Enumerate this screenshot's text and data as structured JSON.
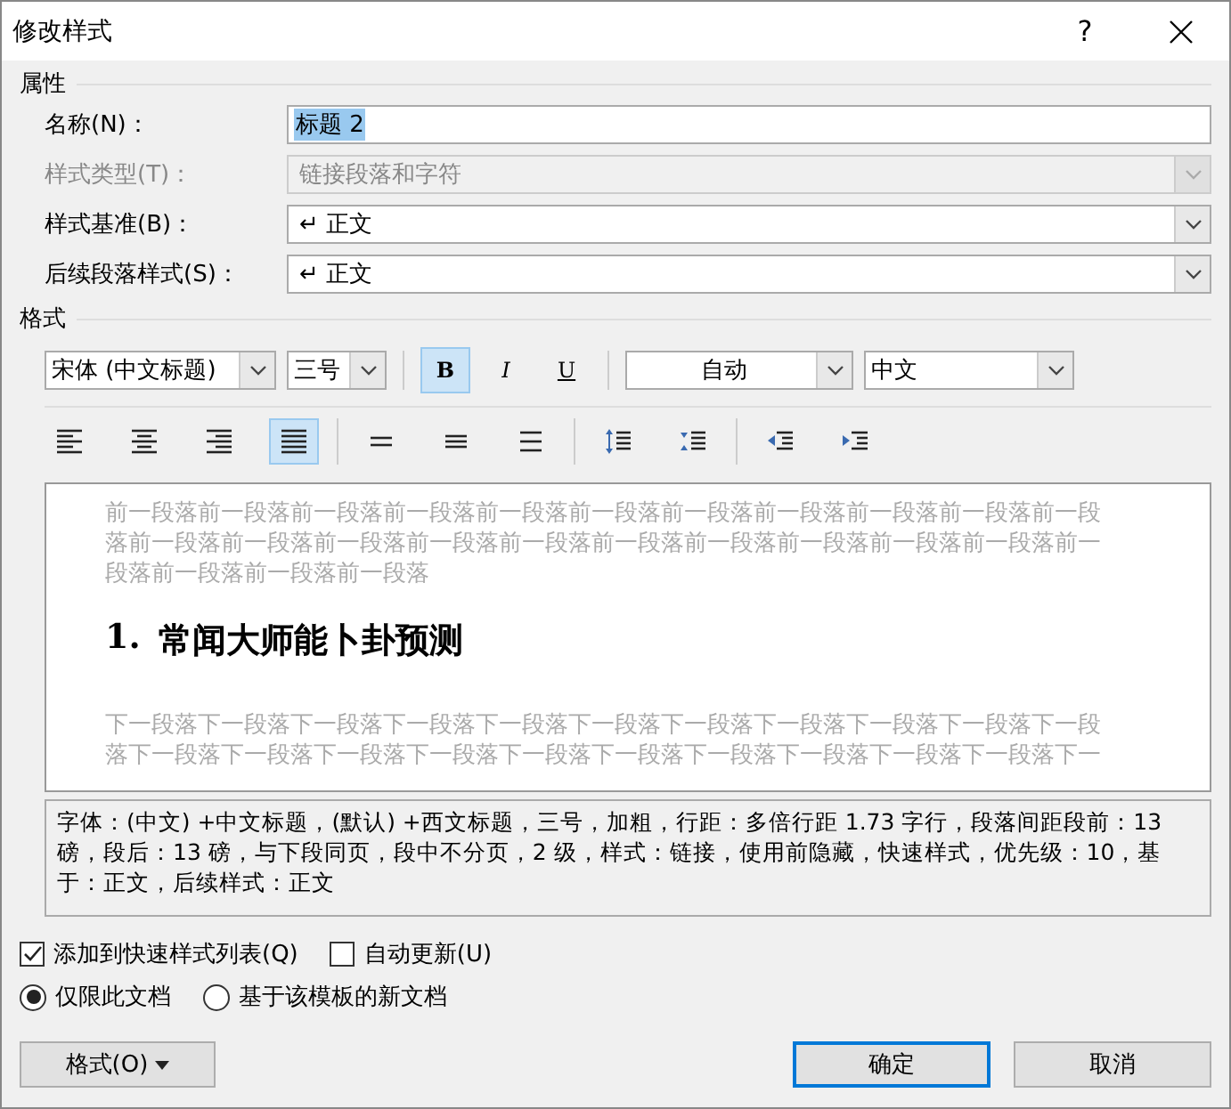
{
  "window": {
    "title": "修改样式",
    "help": "?"
  },
  "properties": {
    "heading": "属性",
    "rows": [
      {
        "label": "名称(N)：",
        "kind": "text",
        "value": "标题 2",
        "disabled": false
      },
      {
        "label": "样式类型(T)：",
        "kind": "combo",
        "value": "链接段落和字符",
        "disabled": true
      },
      {
        "label": "样式基准(B)：",
        "kind": "combo",
        "value": "↵ 正文",
        "disabled": false
      },
      {
        "label": "后续段落样式(S)：",
        "kind": "combo",
        "value": "↵ 正文",
        "disabled": false
      }
    ]
  },
  "format": {
    "heading": "格式",
    "font": "宋体 (中文标题)",
    "size": "三号",
    "styles": [
      {
        "label": "B",
        "kind": "bold",
        "selected": true
      },
      {
        "label": "I",
        "kind": "italic",
        "selected": false
      },
      {
        "label": "U",
        "kind": "underline",
        "selected": false
      }
    ],
    "color_option": "自动",
    "language": "中文",
    "paragraph_groups": [
      [
        {
          "kind": "align-left",
          "selected": false
        },
        {
          "kind": "align-center",
          "selected": false
        },
        {
          "kind": "align-right",
          "selected": false
        },
        {
          "kind": "justify",
          "selected": true
        }
      ],
      [
        {
          "kind": "single",
          "selected": false
        },
        {
          "kind": "one-half",
          "selected": false
        },
        {
          "kind": "double",
          "selected": false
        }
      ],
      [
        {
          "kind": "space-up",
          "selected": false
        },
        {
          "kind": "space-down",
          "selected": false
        }
      ],
      [
        {
          "kind": "outdent",
          "selected": false
        },
        {
          "kind": "indent",
          "selected": false
        }
      ]
    ]
  },
  "preview": {
    "before": "前一段落前一段落前一段落前一段落前一段落前一段落前一段落前一段落前一段落前一段落前一段落前一段落前一段落前一段落前一段落前一段落前一段落前一段落前一段落前一段落前一段落前一段落前一段落前一段落前一段落",
    "number": "1.",
    "heading": "常闻大师能卜卦预测",
    "after": "下一段落下一段落下一段落下一段落下一段落下一段落下一段落下一段落下一段落下一段落下一段落下一段落下一段落下一段落下一段落下一段落下一段落下一段落下一段落下一段落下一段落下一"
  },
  "description": "字体：(中文) +中文标题，(默认) +西文标题，三号，加粗，行距：多倍行距 1.73 字行，段落间距段前：13 磅，段后：13 磅，与下段同页，段中不分页，2 级，样式：链接，使用前隐藏，快速样式，优先级：10，基于：正文，后续样式：正文",
  "checkboxes": [
    {
      "label": "添加到快速样式列表(Q)",
      "checked": true
    },
    {
      "label": "自动更新(U)",
      "checked": false
    }
  ],
  "radios": [
    {
      "label": "仅限此文档",
      "selected": true
    },
    {
      "label": "基于该模板的新文档",
      "selected": false
    }
  ],
  "buttons": {
    "format": "格式(O)",
    "ok": "确定",
    "cancel": "取消"
  }
}
